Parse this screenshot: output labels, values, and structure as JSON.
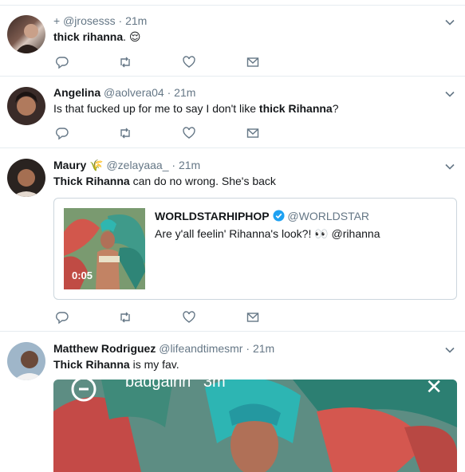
{
  "colors": {
    "border": "#e6ecf0",
    "muted": "#657786",
    "verified": "#1da1f2",
    "text": "#14171a"
  },
  "tweets": [
    {
      "plus": "+",
      "handle": "@jrosesss",
      "sep": "·",
      "time": "21m",
      "text_bold": "thick rihanna",
      "text_rest": ". 😌",
      "avatar_icon": "avatar-photo"
    },
    {
      "name": "Angelina",
      "handle": "@aolvera04",
      "sep": "·",
      "time": "21m",
      "text_pre": "Is that fucked up for me to say I don't like ",
      "text_bold": "thick Rihanna",
      "text_post": "?",
      "avatar_icon": "avatar-photo"
    },
    {
      "name": "Maury",
      "name_emoji": "🌾",
      "handle": "@zelayaaa_",
      "sep": "·",
      "time": "21m",
      "text_bold": "Thick Rihanna",
      "text_rest": " can do no wrong. She's back",
      "quote": {
        "name": "WORLDSTARHIPHOP",
        "handle": "@WORLDSTAR",
        "text": "Are y'all feelin' Rihanna's look?! 👀 @rihanna",
        "duration": "0:05"
      },
      "avatar_icon": "avatar-photo"
    },
    {
      "name": "Matthew Rodriguez",
      "handle": "@lifeandtimesmr",
      "sep": "·",
      "time": "21m",
      "text_bold": "Thick Rihanna",
      "text_rest": " is my fav.",
      "media_overlay_user": "badgalriri",
      "media_overlay_time": "3m",
      "media_close": "✕",
      "avatar_icon": "avatar-photo"
    }
  ],
  "action_icons": [
    "reply-icon",
    "retweet-icon",
    "like-icon",
    "dm-icon"
  ]
}
